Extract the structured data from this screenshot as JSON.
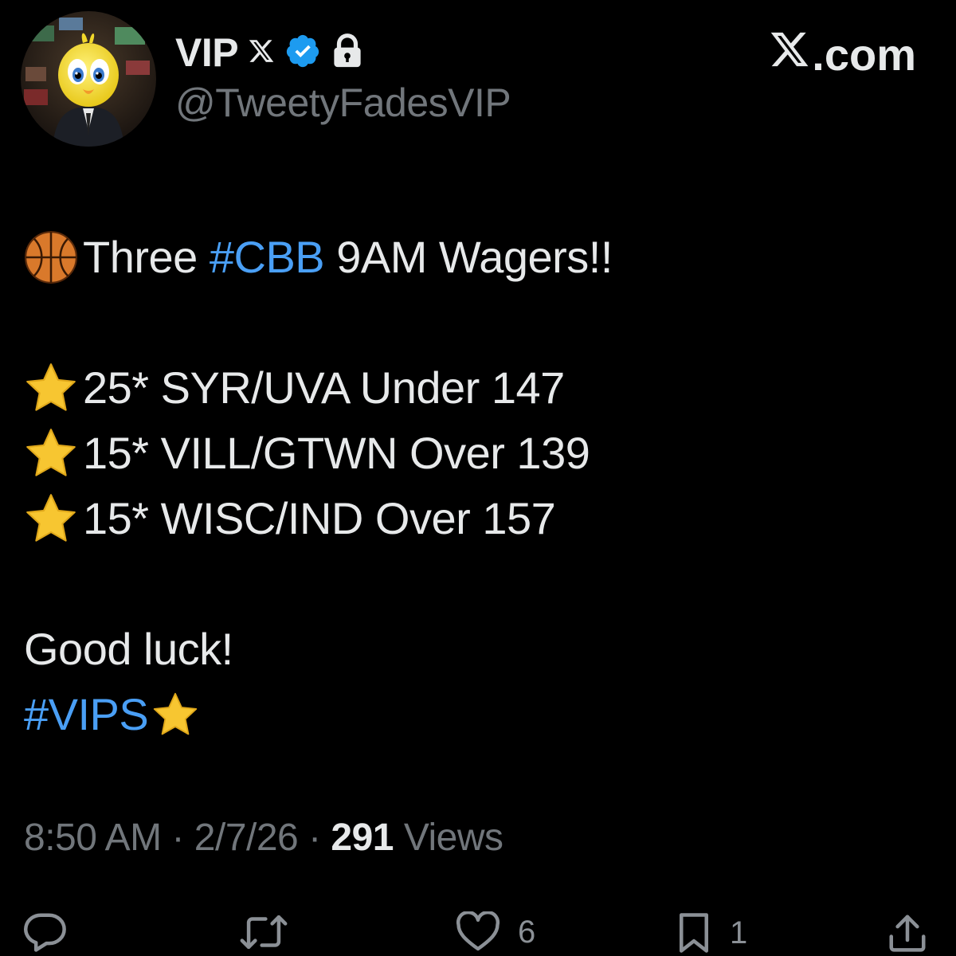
{
  "author": {
    "display_name": "VIP",
    "handle": "@TweetyFadesVIP",
    "verified_icon": "verified-badge-icon",
    "protected_icon": "lock-icon",
    "x_logo_icon": "x-logo-icon"
  },
  "brand": {
    "logo_icon": "x-logo-icon",
    "suffix": ".com"
  },
  "tweet": {
    "line1": {
      "emoji": "basketball-icon",
      "text_before": "Three",
      "hashtag": "#CBB",
      "text_after": "9AM Wagers!!"
    },
    "picks": [
      {
        "emoji": "star-icon",
        "text": "25* SYR/UVA Under 147"
      },
      {
        "emoji": "star-icon",
        "text": "15* VILL/GTWN Over 139"
      },
      {
        "emoji": "star-icon",
        "text": "15* WISC/IND Over 157"
      }
    ],
    "closing": "Good luck!",
    "closing_hashtag": "#VIPS",
    "closing_emoji": "star-icon"
  },
  "meta": {
    "time": "8:50 AM",
    "separator": "·",
    "date": "2/7/26",
    "views_count": "291",
    "views_label": "Views"
  },
  "actions": {
    "reply": {
      "icon": "reply-icon",
      "count": ""
    },
    "repost": {
      "icon": "repost-icon",
      "count": ""
    },
    "like": {
      "icon": "heart-icon",
      "count": "6"
    },
    "bookmark": {
      "icon": "bookmark-icon",
      "count": "1"
    },
    "share": {
      "icon": "share-icon",
      "count": ""
    }
  },
  "colors": {
    "background": "#000000",
    "text": "#e7e9ea",
    "secondary": "#71767b",
    "hashtag": "#4a9ff5",
    "verified": "#1d9bf0",
    "star": "#f7c631",
    "basketball": "#d9792b"
  }
}
